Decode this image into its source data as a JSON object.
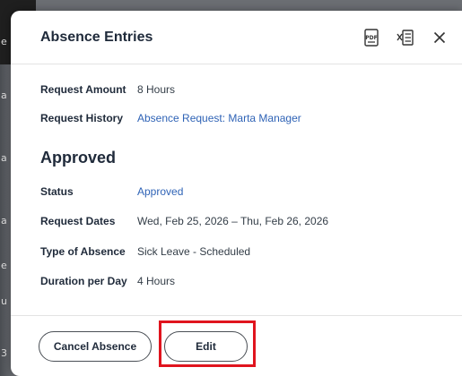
{
  "modal": {
    "title": "Absence Entries",
    "icons": [
      "pdf-export-icon",
      "excel-export-icon",
      "close-icon"
    ],
    "pdf_icon_text": "PDF"
  },
  "backdrop": {
    "edge_glyphs": [
      "e",
      "a",
      "a",
      "a",
      "e",
      "u",
      "3"
    ]
  },
  "request": {
    "amount_label": "Request Amount",
    "amount_value": "8 Hours",
    "history_label": "Request History",
    "history_value": "Absence Request: Marta Manager"
  },
  "approved": {
    "section_title": "Approved",
    "status_label": "Status",
    "status_value": "Approved",
    "dates_label": "Request Dates",
    "dates_value": "Wed, Feb 25, 2026 – Thu, Feb 26, 2026",
    "type_label": "Type of Absence",
    "type_value": "Sick Leave - Scheduled",
    "duration_label": "Duration per Day",
    "duration_value": "4 Hours"
  },
  "footer": {
    "cancel_label": "Cancel Absence",
    "edit_label": "Edit"
  },
  "colors": {
    "link": "#2f63b6",
    "highlight": "#e0141e",
    "text": "#1f2a3a"
  }
}
